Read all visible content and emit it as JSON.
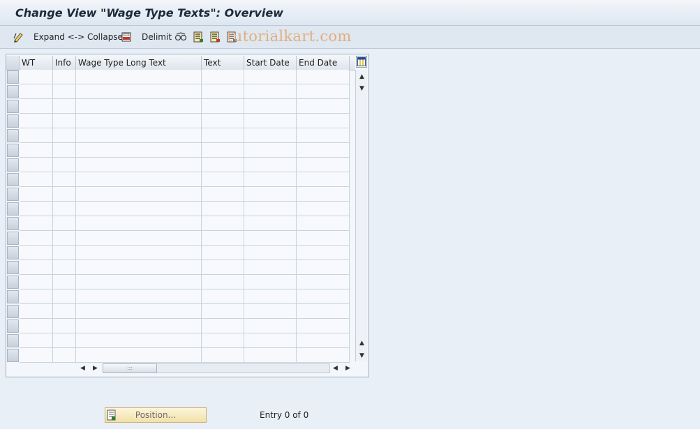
{
  "window": {
    "title": "Change View \"Wage Type Texts\": Overview"
  },
  "toolbar": {
    "expand_collapse_label": "Expand <-> Collapse",
    "delimit_label": "Delimit",
    "icons": [
      "edit-pencil-icon",
      "save-print-icon",
      "transport-glasses-icon",
      "select-all-icon",
      "select-block-icon",
      "deselect-all-icon"
    ]
  },
  "watermark": {
    "text": "tutorialkart.com"
  },
  "table": {
    "columns": [
      "WT",
      "Info",
      "Wage Type Long Text",
      "Text",
      "Start Date",
      "End Date"
    ],
    "rows": [],
    "visible_empty_rows": 20,
    "hscroll_grip": ":::"
  },
  "footer": {
    "position_button_label": "Position...",
    "entry_text": "Entry 0 of 0"
  },
  "colors": {
    "background": "#e9eff6",
    "title": "#1c2a3a",
    "watermark": "#e2a56c",
    "position_button": "#f5e8bd"
  }
}
